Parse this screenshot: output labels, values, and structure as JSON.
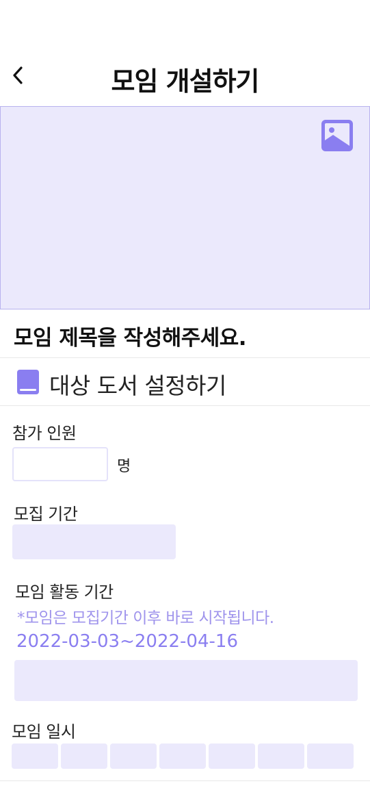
{
  "header": {
    "title": "모임 개설하기",
    "back_icon": "chevron-left-icon"
  },
  "cover": {
    "icon": "image-icon",
    "accent": "#8a7ef0"
  },
  "meeting": {
    "title_placeholder": "모임 제목을 작성해주세요."
  },
  "book": {
    "icon": "book-icon",
    "label": "대상 도서 설정하기"
  },
  "participants": {
    "label": "참가 인원",
    "value": "",
    "unit": "명"
  },
  "recruit_period": {
    "label": "모집 기간",
    "value": ""
  },
  "activity_period": {
    "label": "모임 활동 기간",
    "note": "*모임은 모집기간 이후 바로 시작됩니다.",
    "range": "2022-03-03~2022-04-16",
    "value": ""
  },
  "schedule": {
    "label": "모임 일시",
    "days": [
      "",
      "",
      "",
      "",
      "",
      "",
      ""
    ]
  },
  "colors": {
    "accent": "#8a7ef0",
    "field_bg": "#ebe9fc",
    "note": "#9f94ec"
  }
}
